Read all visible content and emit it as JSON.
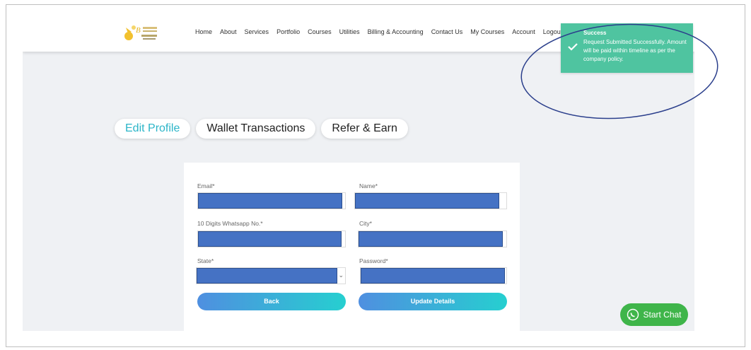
{
  "brand": {
    "logo": "logo-image"
  },
  "nav": {
    "items": [
      "Home",
      "About",
      "Services",
      "Portfolio",
      "Courses",
      "Utilities",
      "Billing & Accounting",
      "Contact Us",
      "My Courses",
      "Account",
      "Logout"
    ]
  },
  "tabs": [
    {
      "label": "Edit Profile",
      "active": true
    },
    {
      "label": "Wallet Transactions",
      "active": false
    },
    {
      "label": "Refer & Earn",
      "active": false
    }
  ],
  "form": {
    "email_label": "Email*",
    "name_label": "Name*",
    "whatsapp_label": "10 Digits Whatsapp No.*",
    "city_label": "City*",
    "state_label": "State*",
    "password_label": "Password*",
    "back_label": "Back",
    "update_label": "Update Details"
  },
  "chat": {
    "label": "Start Chat"
  },
  "toast": {
    "title": "Success",
    "message": "Request Submitted Successfully. Amount will be paid within timeline as per the company policy."
  },
  "colors": {
    "accent": "#2bb5c8",
    "toast": "#4fc4a0",
    "chat": "#3fb54a",
    "redaction": "#4572c4",
    "annotation": "#2b3f8c"
  }
}
